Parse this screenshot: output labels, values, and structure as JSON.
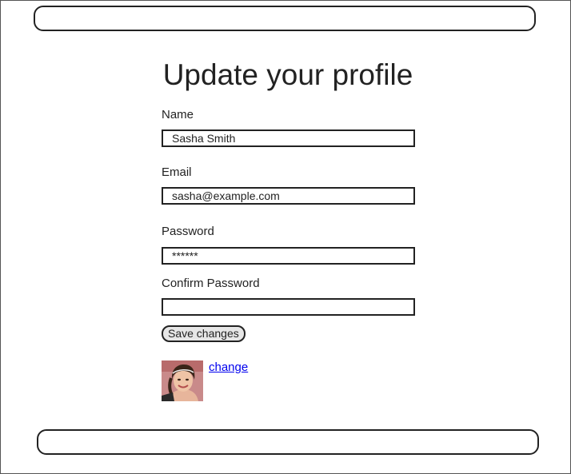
{
  "page": {
    "title": "Update your profile"
  },
  "form": {
    "name_label": "Name",
    "name_value": "Sasha Smith",
    "email_label": "Email",
    "email_value": "sasha@example.com",
    "password_label": "Password",
    "password_value": "******",
    "confirm_password_label": "Confirm Password",
    "confirm_password_value": "",
    "save_label": "Save changes"
  },
  "avatar": {
    "change_label": "change"
  },
  "colors": {
    "border": "#222222",
    "button_bg": "#e6e6e6",
    "link": "#0000ee"
  }
}
